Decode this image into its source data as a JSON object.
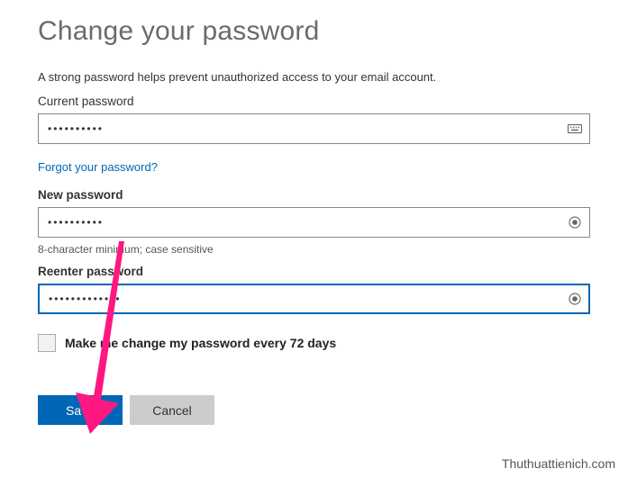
{
  "title": "Change your password",
  "subtitle": "A strong password helps prevent unauthorized access to your email account.",
  "current": {
    "label": "Current password",
    "value": "••••••••••"
  },
  "forgot": "Forgot your password?",
  "newPassword": {
    "label": "New password",
    "value": "••••••••••"
  },
  "hint": "8-character minimum; case sensitive",
  "reenter": {
    "label": "Reenter password",
    "value": "•••••••••••••"
  },
  "checkbox": {
    "label": "Make me change my password every 72 days"
  },
  "buttons": {
    "save": "Save",
    "cancel": "Cancel"
  },
  "watermark": "Thuthuattienich.com"
}
